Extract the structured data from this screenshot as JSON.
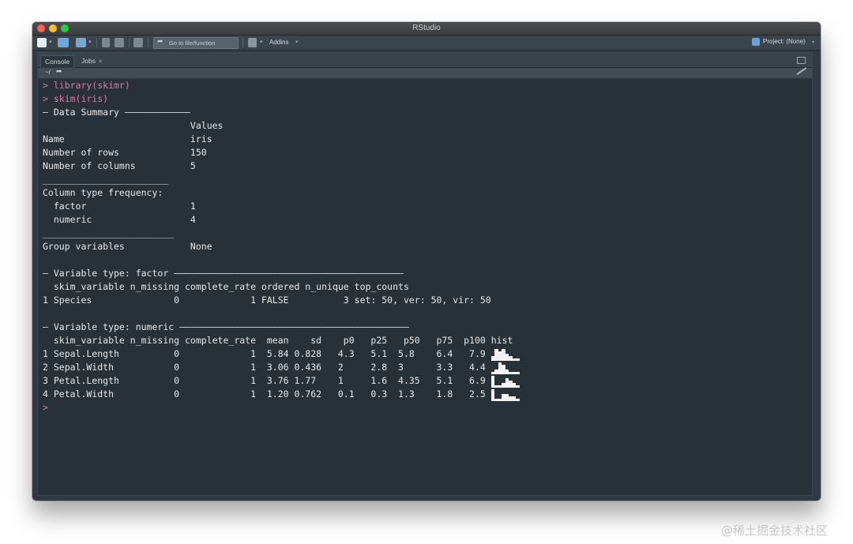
{
  "window": {
    "title": "RStudio"
  },
  "toolbar": {
    "goto_placeholder": "Go to file/function",
    "addins_label": "Addins",
    "project_label": "Project: (None)"
  },
  "tabs": [
    {
      "label": "Console"
    },
    {
      "label": "Jobs"
    }
  ],
  "path": "~/",
  "console": {
    "lines": [
      {
        "text": "> library(skimr)",
        "kind": "cmd"
      },
      {
        "text": "> skim(iris)",
        "kind": "cmd"
      },
      {
        "text": "— Data Summary ————————————",
        "kind": "out"
      },
      {
        "text": "                           Values",
        "kind": "out"
      },
      {
        "text": "Name                       iris",
        "kind": "out"
      },
      {
        "text": "Number of rows             150",
        "kind": "out"
      },
      {
        "text": "Number of columns          5",
        "kind": "out"
      },
      {
        "text": "_______________________",
        "kind": "out"
      },
      {
        "text": "Column type frequency:",
        "kind": "out"
      },
      {
        "text": "  factor                   1",
        "kind": "out"
      },
      {
        "text": "  numeric                  4",
        "kind": "out"
      },
      {
        "text": "________________________",
        "kind": "out"
      },
      {
        "text": "Group variables            None",
        "kind": "out"
      },
      {
        "text": "",
        "kind": "out"
      },
      {
        "text": "— Variable type: factor ——————————————————————————————————————————",
        "kind": "out"
      },
      {
        "text": "  skim_variable n_missing complete_rate ordered n_unique top_counts",
        "kind": "out"
      },
      {
        "text": "1 Species               0             1 FALSE          3 set: 50, ver: 50, vir: 50",
        "kind": "out"
      },
      {
        "text": "",
        "kind": "out"
      },
      {
        "text": "— Variable type: numeric ——————————————————————————————————————————",
        "kind": "out"
      },
      {
        "text": "  skim_variable n_missing complete_rate  mean    sd    p0   p25   p50   p75  p100 hist",
        "kind": "out"
      },
      {
        "text": "1 Sepal.Length          0             1  5.84 0.828   4.3   5.1  5.8    6.4   7.9 ",
        "kind": "out",
        "hist": [
          2,
          5,
          4,
          5,
          3,
          2,
          1,
          1
        ]
      },
      {
        "text": "2 Sepal.Width           0             1  3.06 0.436   2     2.8  3      3.3   4.4 ",
        "kind": "out",
        "hist": [
          1,
          2,
          5,
          4,
          2,
          1,
          1,
          1
        ]
      },
      {
        "text": "3 Petal.Length          0             1  3.76 1.77    1     1.6  4.35   5.1   6.9 ",
        "kind": "out",
        "hist": [
          5,
          1,
          1,
          2,
          4,
          3,
          2,
          1
        ]
      },
      {
        "text": "4 Petal.Width           0             1  1.20 0.762   0.1   0.3  1.3    1.8   2.5 ",
        "kind": "out",
        "hist": [
          5,
          1,
          1,
          3,
          3,
          2,
          2,
          1
        ]
      },
      {
        "text": ">",
        "kind": "prompt"
      }
    ]
  },
  "watermark": "@稀土掘金技术社区",
  "colors": {
    "console_bg": "#283138",
    "command": "#d97aa9",
    "text": "#e6e8ea"
  }
}
